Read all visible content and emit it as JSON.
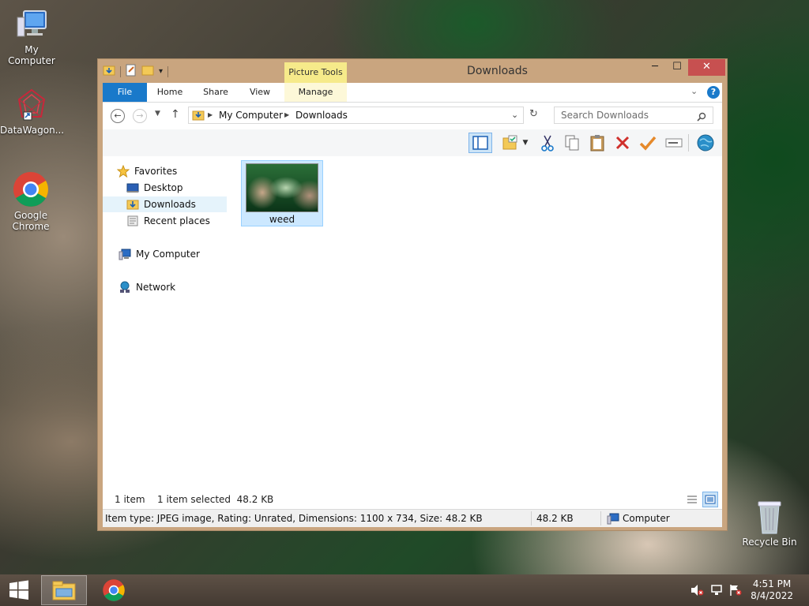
{
  "desktop": {
    "icons": [
      {
        "label": "My Computer"
      },
      {
        "label": "DataWagon..."
      },
      {
        "label": "Google Chrome"
      },
      {
        "label": "Recycle Bin"
      }
    ]
  },
  "window": {
    "title": "Downloads",
    "contextual_tab": "Picture Tools",
    "controls": {
      "minimize": "─",
      "maximize": "☐",
      "close": "✕"
    }
  },
  "ribbon": {
    "tabs": [
      "File",
      "Home",
      "Share",
      "View",
      "Manage"
    ],
    "help": "?"
  },
  "address": {
    "crumbs": [
      "My Computer",
      "Downloads"
    ],
    "search_placeholder": "Search Downloads"
  },
  "nav": {
    "favorites": "Favorites",
    "desktop": "Desktop",
    "downloads": "Downloads",
    "recent": "Recent places",
    "computer": "My Computer",
    "network": "Network"
  },
  "files": [
    {
      "name": "weed"
    }
  ],
  "status": {
    "count": "1 item",
    "selected": "1 item selected  48.2 KB"
  },
  "details_bar": {
    "info": "Item type: JPEG image, Rating: Unrated, Dimensions: 1100 x 734, Size: 48.2 KB",
    "size": "48.2 KB",
    "location": "Computer"
  },
  "taskbar": {
    "time": "4:51 PM",
    "date": "8/4/2022"
  },
  "colors": {
    "accent": "#1979ca",
    "window_frame": "#c9a57f",
    "selection": "#cce8ff",
    "close": "#c75050",
    "picture_tools": "#f6ea8a"
  }
}
